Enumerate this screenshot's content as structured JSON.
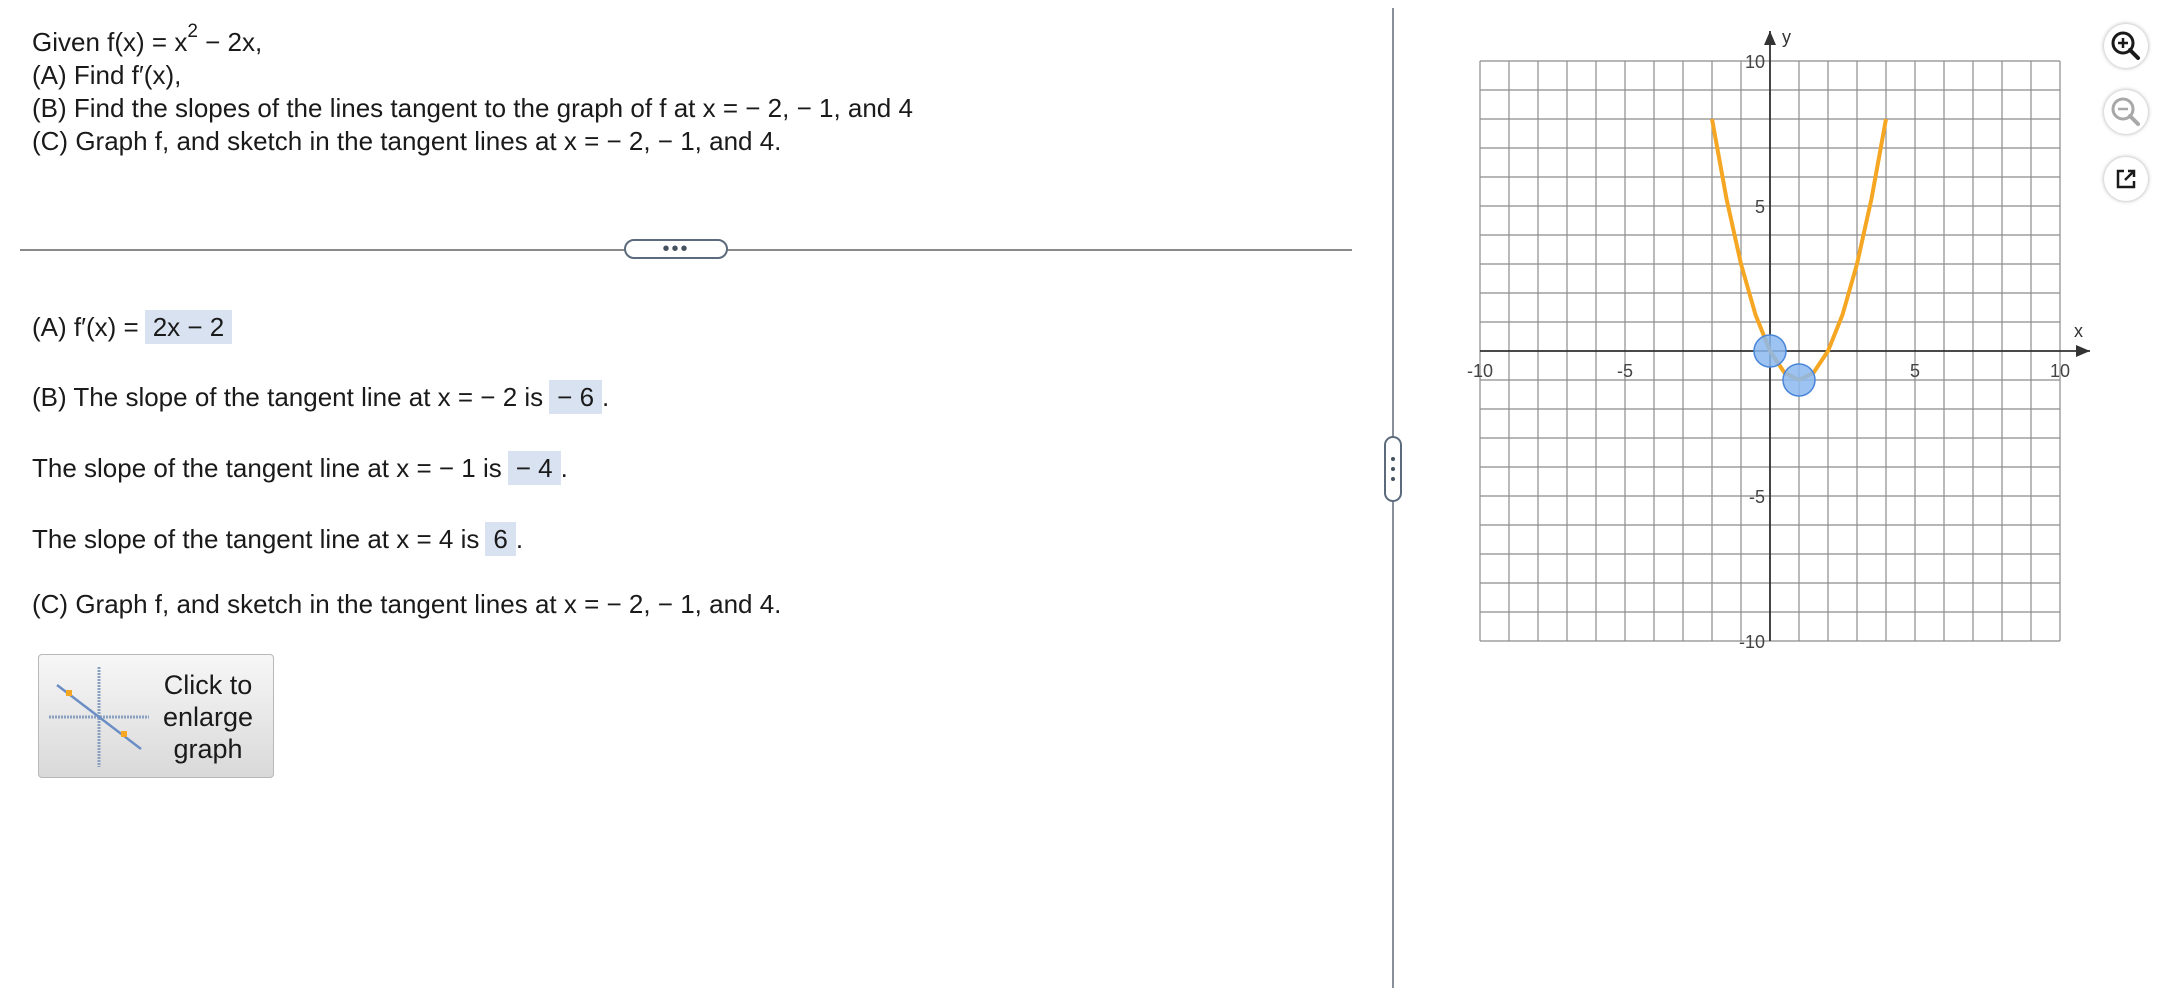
{
  "problem": {
    "given_prefix": "Given f(x) = x",
    "given_exp": "2",
    "given_suffix": " − 2x,",
    "part_a": "(A)  Find f′(x),",
    "part_b": "(B)  Find the slopes of the lines tangent to the graph of f at x = − 2,  − 1, and 4",
    "part_c": "(C)  Graph f, and sketch in the tangent lines at x = − 2,  − 1, and 4."
  },
  "divider": {
    "handle_label": "•••"
  },
  "answers": {
    "a_prefix": "(A)  f′(x) =",
    "a_value": "2x − 2",
    "b1_prefix": "(B)  The slope of the tangent line at x = − 2 is",
    "b1_value": "− 6",
    "b2_prefix": "The slope of the tangent line at x = − 1 is",
    "b2_value": "− 4",
    "b3_prefix": "The slope of the tangent line at x = 4 is",
    "b3_value": "6",
    "period": ".",
    "c_text": "(C)  Graph f, and sketch in the tangent lines at x = − 2,  − 1, and 4."
  },
  "enlarge_button": {
    "line1": "Click to",
    "line2": "enlarge",
    "line3": "graph"
  },
  "tools": {
    "zoom_in": "zoom-in-icon",
    "zoom_out": "zoom-out-icon",
    "popout": "external-link-icon"
  },
  "colors": {
    "curve": "#f5a623",
    "point_fill": "#8bb8ef",
    "point_stroke": "#4a86d8",
    "grid": "#8c8c8c",
    "answer_box": "#d8e2f0"
  },
  "chart_data": {
    "type": "line",
    "function": "x^2 - 2x",
    "xlabel": "x",
    "ylabel": "y",
    "xlim": [
      -10,
      10
    ],
    "ylim": [
      -10,
      10
    ],
    "grid": true,
    "grid_step": 1,
    "x_tick_labels": [
      "-10",
      "-5",
      "5",
      "10"
    ],
    "y_tick_labels": [
      "10",
      "5",
      "-5",
      "-10"
    ],
    "x": [
      -2,
      -1.5,
      -1,
      -0.5,
      0,
      0.5,
      1,
      1.5,
      2,
      2.5,
      3,
      3.5,
      4
    ],
    "y": [
      8,
      5.25,
      3,
      1.25,
      0,
      -0.75,
      -1,
      -0.75,
      0,
      1.25,
      3,
      5.25,
      8
    ],
    "points": [
      {
        "x": 0,
        "y": 0
      },
      {
        "x": 1,
        "y": -1
      }
    ]
  }
}
